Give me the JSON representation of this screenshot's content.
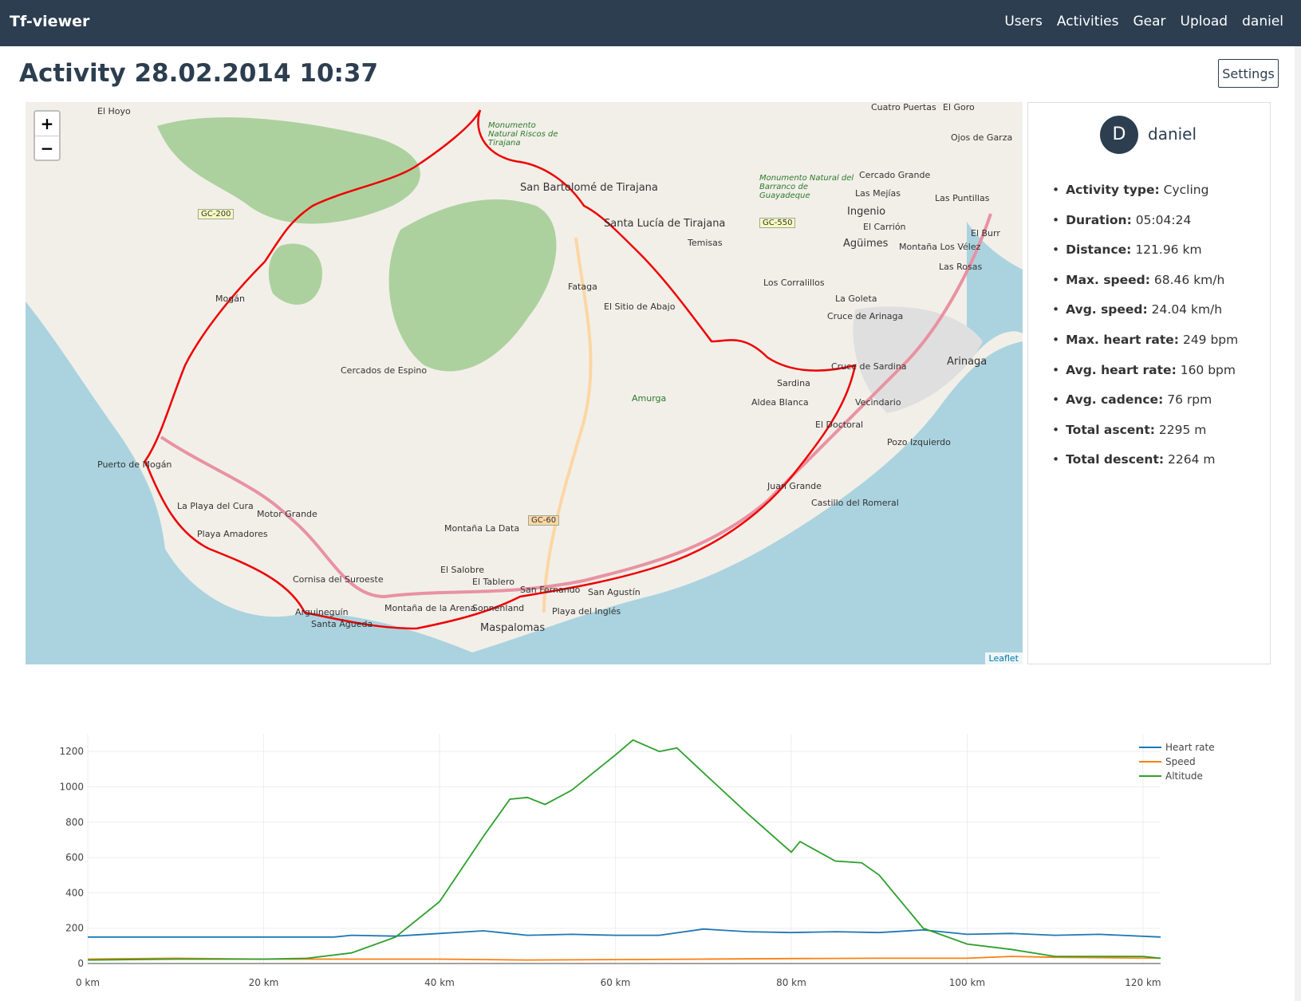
{
  "navbar": {
    "brand": "Tf-viewer",
    "links": [
      "Users",
      "Activities",
      "Gear",
      "Upload",
      "daniel"
    ]
  },
  "page": {
    "title": "Activity 28.02.2014 10:37",
    "settings_label": "Settings"
  },
  "map": {
    "zoom_in": "+",
    "zoom_out": "−",
    "attribution": "Leaflet",
    "labels": [
      "El Hoyo",
      "Mogán",
      "Cercados de Espino",
      "Puerto de Mogán",
      "La Playa del Cura",
      "Motor Grande",
      "Playa Amadores",
      "Cornisa del Suroeste",
      "Arguineguín",
      "Santa Águeda",
      "Montaña de la Arena",
      "El Salobre",
      "Montaña La Data",
      "El Tablero",
      "San Fernando",
      "San Agustín",
      "Sonnenland",
      "Playa del Inglés",
      "Maspalomas",
      "Fataga",
      "El Sitio de Abajo",
      "Amurga",
      "San Bartolomé de Tirajana",
      "Santa Lucía de Tirajana",
      "Temisas",
      "Los Corralillos",
      "Ingenio",
      "El Carrión",
      "Agüimes",
      "Cercado Grande",
      "Las Mejías",
      "Las Puntillas",
      "Cuatro Puertas",
      "El Goro",
      "Ojos de Garza",
      "Montaña Los Vélez",
      "Las Rosas",
      "El Burr",
      "La Goleta",
      "Cruce de Arinaga",
      "Arinaga",
      "Cruce de Sardina",
      "Sardina",
      "Aldea Blanca",
      "Vecindario",
      "El Doctoral",
      "Pozo Izquierdo",
      "Juan Grande",
      "Castillo del Romeral",
      "GC-200",
      "GC-550",
      "GC-60",
      "Monumento Natural Riscos de Tirajana",
      "Monumento Natural del Barranco de Guayadeque"
    ]
  },
  "profile": {
    "avatar_letter": "D",
    "name": "daniel",
    "stats": [
      {
        "label": "Activity type:",
        "value": "Cycling"
      },
      {
        "label": "Duration:",
        "value": "05:04:24"
      },
      {
        "label": "Distance:",
        "value": "121.96 km"
      },
      {
        "label": "Max. speed:",
        "value": "68.46 km/h"
      },
      {
        "label": "Avg. speed:",
        "value": "24.04 km/h"
      },
      {
        "label": "Max. heart rate:",
        "value": "249 bpm"
      },
      {
        "label": "Avg. heart rate:",
        "value": "160 bpm"
      },
      {
        "label": "Avg. cadence:",
        "value": "76 rpm"
      },
      {
        "label": "Total ascent:",
        "value": "2295 m"
      },
      {
        "label": "Total descent:",
        "value": "2264 m"
      }
    ]
  },
  "chart_data": {
    "type": "line",
    "x_unit": "km",
    "xlim": [
      0,
      122
    ],
    "ylim": [
      0,
      1300
    ],
    "x_ticks": [
      "0 km",
      "20 km",
      "40 km",
      "60 km",
      "80 km",
      "100 km",
      "120 km"
    ],
    "y_ticks": [
      "0",
      "200",
      "400",
      "600",
      "800",
      "1000",
      "1200"
    ],
    "legend_position": "top-right",
    "grid": true,
    "series": [
      {
        "name": "Heart rate",
        "color": "#1f77b4",
        "x": [
          0,
          10,
          20,
          28,
          30,
          35,
          40,
          45,
          50,
          55,
          60,
          65,
          70,
          75,
          80,
          85,
          90,
          95,
          100,
          105,
          110,
          115,
          122
        ],
        "y": [
          150,
          150,
          150,
          150,
          160,
          155,
          170,
          185,
          160,
          165,
          160,
          160,
          195,
          180,
          175,
          180,
          175,
          190,
          165,
          170,
          160,
          165,
          150
        ]
      },
      {
        "name": "Speed",
        "color": "#ff7f0e",
        "x": [
          0,
          10,
          20,
          30,
          40,
          50,
          60,
          70,
          80,
          90,
          100,
          105,
          110,
          122
        ],
        "y": [
          25,
          30,
          25,
          25,
          25,
          20,
          22,
          25,
          28,
          30,
          30,
          40,
          35,
          30
        ]
      },
      {
        "name": "Altitude",
        "color": "#2ca02c",
        "x": [
          0,
          10,
          20,
          25,
          30,
          35,
          40,
          45,
          48,
          50,
          52,
          55,
          58,
          60,
          62,
          65,
          67,
          70,
          75,
          80,
          81,
          85,
          88,
          90,
          95,
          100,
          105,
          110,
          115,
          120,
          122
        ],
        "y": [
          20,
          25,
          25,
          30,
          60,
          150,
          350,
          720,
          930,
          940,
          900,
          980,
          1100,
          1180,
          1265,
          1200,
          1220,
          1080,
          850,
          630,
          690,
          580,
          570,
          500,
          200,
          110,
          80,
          40,
          40,
          40,
          30
        ]
      }
    ]
  }
}
